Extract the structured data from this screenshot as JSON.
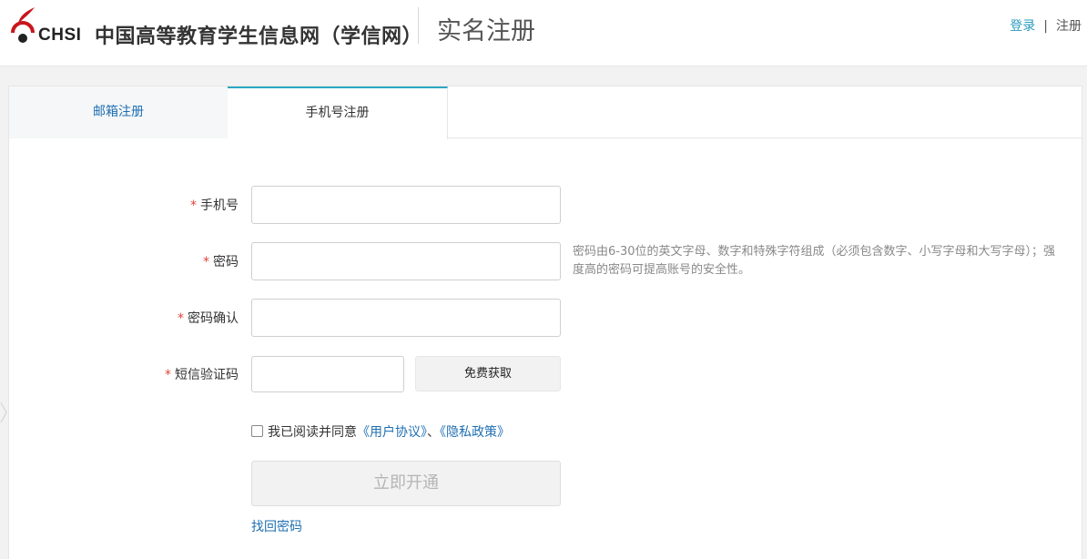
{
  "header": {
    "logo_text": "CHSI",
    "site_name": "中国高等教育学生信息网（学信网）",
    "page_title": "实名注册",
    "links": {
      "login": "登录",
      "separator": "|",
      "register": "注册"
    }
  },
  "tabs": [
    {
      "label": "邮箱注册",
      "active": false
    },
    {
      "label": "手机号注册",
      "active": true
    }
  ],
  "form": {
    "required_mark": "*",
    "phone": {
      "label": "手机号",
      "value": "",
      "placeholder": ""
    },
    "password": {
      "label": "密码",
      "value": "",
      "placeholder": "",
      "hint": "密码由6-30位的英文字母、数字和特殊字符组成（必须包含数字、小写字母和大写字母）；强度高的密码可提高账号的安全性。"
    },
    "password_confirm": {
      "label": "密码确认",
      "value": "",
      "placeholder": ""
    },
    "sms_code": {
      "label": "短信验证码",
      "value": "",
      "placeholder": "",
      "button": "免费获取"
    },
    "agreement": {
      "checked": false,
      "text": "我已阅读并同意",
      "user_agreement": "《用户协议》",
      "separator": "、",
      "privacy_policy": "《隐私政策》"
    },
    "submit_label": "立即开通",
    "recover_link": "找回密码"
  },
  "colors": {
    "accent": "#2ba7c1",
    "link": "#1f6fb2",
    "required": "#e0423b",
    "logo_red": "#c8161d"
  }
}
